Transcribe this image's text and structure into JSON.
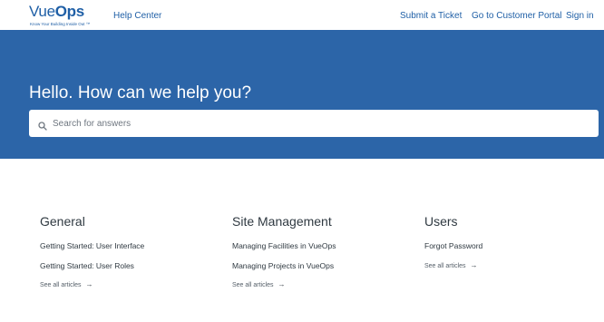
{
  "header": {
    "logo_light": "Vue",
    "logo_bold": "Ops",
    "logo_tagline": "Know Your Building Inside Out ™",
    "help_center": "Help Center",
    "submit_ticket": "Submit a Ticket",
    "customer_portal": "Go to Customer Portal",
    "sign_in": "Sign in"
  },
  "hero": {
    "title": "Hello. How can we help you?",
    "search_placeholder": "Search for answers",
    "search_icon": "search-icon"
  },
  "sections": [
    {
      "title": "General",
      "articles": [
        "Getting Started: User Interface",
        "Getting Started: User Roles"
      ],
      "see_all": "See all articles"
    },
    {
      "title": "Site Management",
      "articles": [
        "Managing Facilities in VueOps",
        "Managing Projects in VueOps"
      ],
      "see_all": "See all articles"
    },
    {
      "title": "Users",
      "articles": [
        "Forgot Password"
      ],
      "see_all": "See all articles"
    }
  ],
  "colors": {
    "brand_blue": "#1f5fa6",
    "hero_background": "#2c65a8",
    "text": "#2f3941"
  }
}
